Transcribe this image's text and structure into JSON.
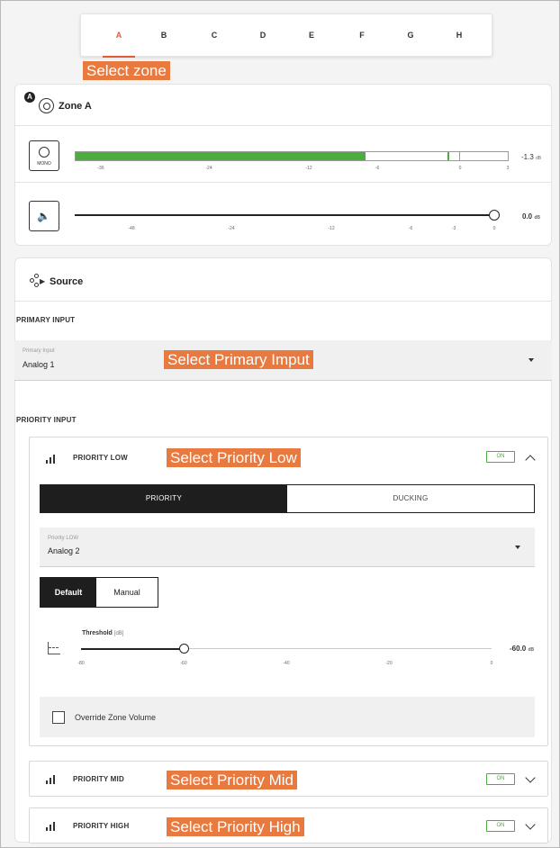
{
  "zones": {
    "tabs": [
      "A",
      "B",
      "C",
      "D",
      "E",
      "F",
      "G",
      "H"
    ],
    "active": "A",
    "callout": "Select zone"
  },
  "zone": {
    "title": "Zone A",
    "badge": "A",
    "meter": {
      "mono_label": "MONO",
      "level_fraction": 0.67,
      "peak_fraction": 0.86,
      "ticks": [
        "-36",
        "-24",
        "-12",
        "-6",
        "0",
        "3"
      ],
      "value": "-1.3",
      "unit": "dB"
    },
    "volume": {
      "level_fraction": 1.0,
      "ticks": [
        "-48",
        "-24",
        "-12",
        "-6",
        "-3",
        "0"
      ],
      "value": "0.0",
      "unit": "dB"
    }
  },
  "source": {
    "title": "Source",
    "primary": {
      "section_label": "PRIMARY INPUT",
      "caption": "Primary Input",
      "value": "Analog 1",
      "callout": "Select Primary Imput"
    },
    "priority_section_label": "PRIORITY INPUT",
    "low": {
      "title": "PRIORITY LOW",
      "status": "ON",
      "callout": "Select Priority Low",
      "tabs": [
        "PRIORITY",
        "DUCKING"
      ],
      "active_tab": "PRIORITY",
      "select_caption": "Priority LOW",
      "select_value": "Analog 2",
      "modes": [
        "Default",
        "Manual"
      ],
      "active_mode": "Default",
      "threshold": {
        "label": "Threshold",
        "unit_label": "[dB]",
        "ticks": [
          "-80",
          "-60",
          "-40",
          "-20",
          "0"
        ],
        "value": "-60.0",
        "unit": "dB",
        "level_fraction": 0.25
      },
      "override_label": "Override Zone Volume",
      "override_checked": false
    },
    "mid": {
      "title": "PRIORITY MID",
      "status": "ON",
      "callout": "Select Priority Mid"
    },
    "high": {
      "title": "PRIORITY HIGH",
      "status": "ON",
      "callout": "Select Priority High"
    }
  },
  "colors": {
    "accent": "#e05a3a",
    "callout": "#e8793f",
    "meter_green": "#4aad3d",
    "dark": "#1e1e1e"
  }
}
